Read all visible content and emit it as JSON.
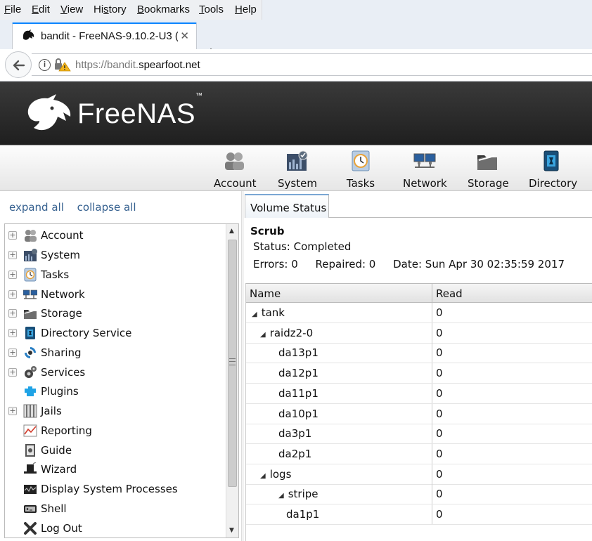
{
  "browser": {
    "menu": [
      {
        "label": "File",
        "accel": "F",
        "rest": "ile"
      },
      {
        "label": "Edit",
        "accel": "E",
        "rest": "dit"
      },
      {
        "label": "View",
        "accel": "V",
        "rest": "iew"
      },
      {
        "label": "History",
        "accel": "s",
        "pre": "Hi",
        "rest": "tory"
      },
      {
        "label": "Bookmarks",
        "accel": "B",
        "rest": "ookmarks"
      },
      {
        "label": "Tools",
        "accel": "T",
        "rest": "ools"
      },
      {
        "label": "Help",
        "accel": "H",
        "rest": "elp"
      }
    ],
    "tab_title": "bandit - FreeNAS-9.10.2-U3 (",
    "new_tab": "+",
    "close": "✕",
    "url_scheme": "https://bandit.",
    "url_host": "spearfoot.net"
  },
  "app": {
    "brand": "FreeNAS",
    "trademark": "™"
  },
  "toolbar": {
    "items": [
      {
        "label": "Account",
        "icon": "account-icon"
      },
      {
        "label": "System",
        "icon": "system-icon"
      },
      {
        "label": "Tasks",
        "icon": "tasks-icon"
      },
      {
        "label": "Network",
        "icon": "network-icon"
      },
      {
        "label": "Storage",
        "icon": "storage-icon"
      },
      {
        "label": "Directory",
        "icon": "directory-icon"
      }
    ]
  },
  "sidebar": {
    "expand_all": "expand all",
    "collapse_all": "collapse all",
    "items": [
      {
        "label": "Account",
        "expandable": true,
        "icon": "account-icon"
      },
      {
        "label": "System",
        "expandable": true,
        "icon": "system-icon"
      },
      {
        "label": "Tasks",
        "expandable": true,
        "icon": "tasks-icon"
      },
      {
        "label": "Network",
        "expandable": true,
        "icon": "network-icon"
      },
      {
        "label": "Storage",
        "expandable": true,
        "icon": "storage-icon"
      },
      {
        "label": "Directory Service",
        "expandable": true,
        "icon": "directory-icon"
      },
      {
        "label": "Sharing",
        "expandable": true,
        "icon": "sharing-icon"
      },
      {
        "label": "Services",
        "expandable": true,
        "icon": "services-icon"
      },
      {
        "label": "Plugins",
        "expandable": false,
        "icon": "plugins-icon"
      },
      {
        "label": "Jails",
        "expandable": true,
        "icon": "jails-icon"
      },
      {
        "label": "Reporting",
        "expandable": false,
        "icon": "reporting-icon"
      },
      {
        "label": "Guide",
        "expandable": false,
        "icon": "guide-icon"
      },
      {
        "label": "Wizard",
        "expandable": false,
        "icon": "wizard-icon"
      },
      {
        "label": "Display System Processes",
        "expandable": false,
        "icon": "processes-icon"
      },
      {
        "label": "Shell",
        "expandable": false,
        "icon": "shell-icon"
      },
      {
        "label": "Log Out",
        "expandable": false,
        "icon": "logout-icon"
      }
    ]
  },
  "volume_status": {
    "tab_label": "Volume Status",
    "scrub_title": "Scrub",
    "status": "Status: Completed",
    "errors": "Errors: 0",
    "repaired": "Repaired: 0",
    "date": "Date: Sun Apr 30 02:35:59 2017",
    "columns": [
      "Name",
      "Read"
    ],
    "rows": [
      {
        "name": "tank",
        "read": "0",
        "level": 0,
        "toggle": true
      },
      {
        "name": "raidz2-0",
        "read": "0",
        "level": 1,
        "toggle": true
      },
      {
        "name": "da13p1",
        "read": "0",
        "level": 2,
        "toggle": false
      },
      {
        "name": "da12p1",
        "read": "0",
        "level": 2,
        "toggle": false
      },
      {
        "name": "da11p1",
        "read": "0",
        "level": 2,
        "toggle": false
      },
      {
        "name": "da10p1",
        "read": "0",
        "level": 2,
        "toggle": false
      },
      {
        "name": "da3p1",
        "read": "0",
        "level": 2,
        "toggle": false
      },
      {
        "name": "da2p1",
        "read": "0",
        "level": 2,
        "toggle": false
      },
      {
        "name": "logs",
        "read": "0",
        "level": 1,
        "toggle": true
      },
      {
        "name": "stripe",
        "read": "0",
        "level": 2,
        "toggle": true
      },
      {
        "name": "da1p1",
        "read": "0",
        "level": 3,
        "toggle": false
      }
    ]
  }
}
